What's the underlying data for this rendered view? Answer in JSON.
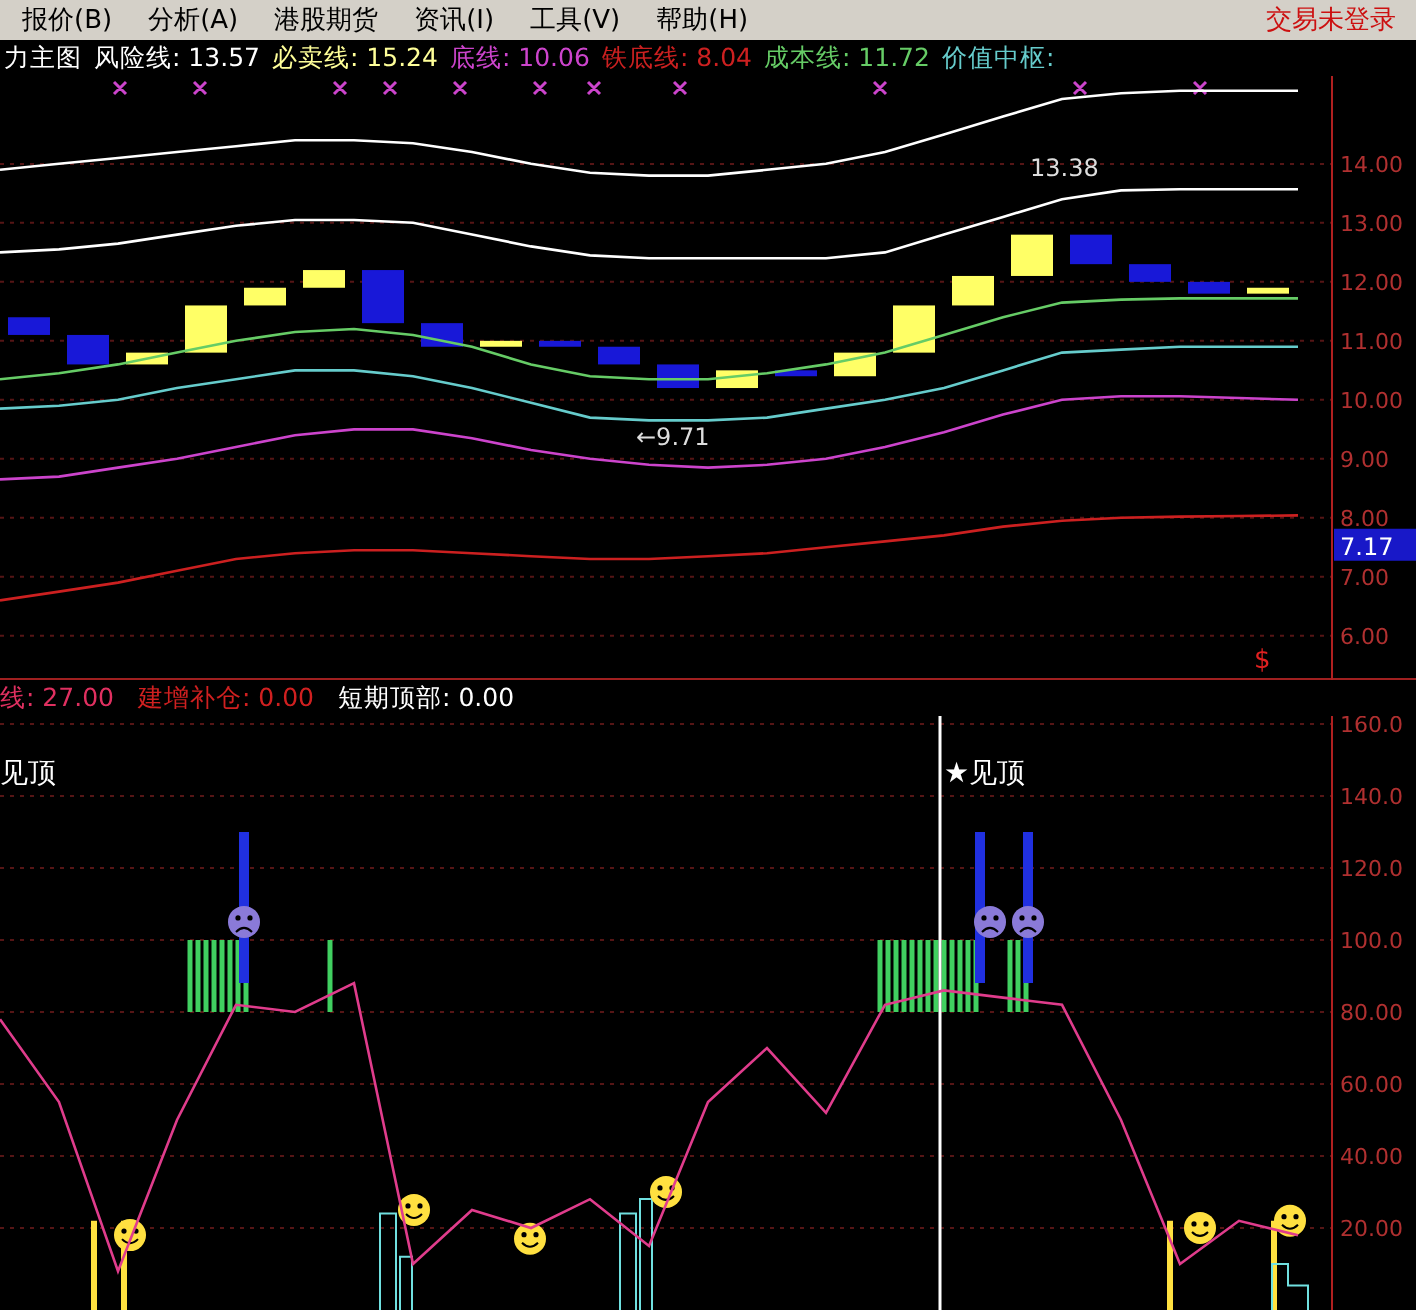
{
  "menu": {
    "items": [
      {
        "label": "报价(B)"
      },
      {
        "label": "分析(A)"
      },
      {
        "label": "港股期货"
      },
      {
        "label": "资讯(I)"
      },
      {
        "label": "工具(V)"
      },
      {
        "label": "帮助(H)"
      }
    ],
    "status": "交易未登录"
  },
  "price_panel": {
    "legend": [
      {
        "kind": "title",
        "label": "力主图",
        "color": "#ffffff"
      },
      {
        "kind": "reading",
        "label": "风险线:",
        "value": "13.57",
        "color": "#ffffff"
      },
      {
        "kind": "reading",
        "label": "必卖线:",
        "value": "15.24",
        "color": "#ffff99"
      },
      {
        "kind": "reading",
        "label": "底线:",
        "value": "10.06",
        "color": "#cc44cc"
      },
      {
        "kind": "reading",
        "label": "铁底线:",
        "value": "8.04",
        "color": "#cc2020"
      },
      {
        "kind": "reading",
        "label": "成本线:",
        "value": "11.72",
        "color": "#66cc66"
      },
      {
        "kind": "title",
        "label": "价值中枢:",
        "color": "#66cccc"
      }
    ],
    "price_tag": "7.17",
    "marker": "$",
    "annotations": [
      {
        "text": "13.38"
      },
      {
        "text": "←9.71"
      }
    ],
    "chart_data": {
      "type": "line",
      "grid": true,
      "ylim": [
        5.25,
        15.49
      ],
      "yticks": [
        {
          "value": 14,
          "label": "14.00"
        },
        {
          "value": 13,
          "label": "13.00"
        },
        {
          "value": 12,
          "label": "12.00"
        },
        {
          "value": 11,
          "label": "11.00"
        },
        {
          "value": 10,
          "label": "10.00"
        },
        {
          "value": 9,
          "label": "9.00"
        },
        {
          "value": 8,
          "label": "8.00"
        },
        {
          "value": 7,
          "label": "7.00"
        },
        {
          "value": 6,
          "label": "6.00"
        }
      ],
      "series": [
        {
          "color": "#ffffff",
          "values": [
            13.9,
            14.0,
            14.1,
            14.2,
            14.3,
            14.4,
            14.4,
            14.35,
            14.2,
            14.0,
            13.85,
            13.8,
            13.8,
            13.9,
            14.0,
            14.2,
            14.5,
            14.8,
            15.1,
            15.2,
            15.24,
            15.24,
            15.24
          ]
        },
        {
          "color": "#ffffff",
          "values": [
            12.5,
            12.55,
            12.65,
            12.8,
            12.95,
            13.05,
            13.05,
            13.0,
            12.8,
            12.6,
            12.45,
            12.4,
            12.4,
            12.4,
            12.4,
            12.5,
            12.8,
            13.1,
            13.4,
            13.55,
            13.57,
            13.57,
            13.57
          ]
        },
        {
          "color": "#66cc66",
          "values": [
            10.35,
            10.45,
            10.6,
            10.8,
            11.0,
            11.15,
            11.2,
            11.1,
            10.9,
            10.6,
            10.4,
            10.35,
            10.35,
            10.45,
            10.6,
            10.8,
            11.1,
            11.4,
            11.65,
            11.7,
            11.72,
            11.72,
            11.72
          ]
        },
        {
          "color": "#66cccc",
          "values": [
            9.85,
            9.9,
            10.0,
            10.2,
            10.35,
            10.5,
            10.5,
            10.4,
            10.2,
            9.95,
            9.7,
            9.65,
            9.65,
            9.7,
            9.85,
            10.0,
            10.2,
            10.5,
            10.8,
            10.85,
            10.9,
            10.9,
            10.9
          ]
        },
        {
          "color": "#cc44cc",
          "values": [
            8.65,
            8.7,
            8.85,
            9.0,
            9.2,
            9.4,
            9.5,
            9.5,
            9.35,
            9.15,
            9.0,
            8.9,
            8.85,
            8.9,
            9.0,
            9.2,
            9.45,
            9.75,
            10.0,
            10.06,
            10.06,
            10.03,
            10.0
          ]
        },
        {
          "color": "#cc2020",
          "values": [
            6.6,
            6.75,
            6.9,
            7.1,
            7.3,
            7.4,
            7.45,
            7.45,
            7.4,
            7.35,
            7.3,
            7.3,
            7.35,
            7.4,
            7.5,
            7.6,
            7.7,
            7.85,
            7.95,
            8.0,
            8.02,
            8.03,
            8.04
          ]
        }
      ]
    }
  },
  "indicator_panel": {
    "legend": [
      {
        "label": "线:",
        "value": "27.00",
        "color": "#e03060"
      },
      {
        "label": "建增补仓:",
        "value": "0.00",
        "color": "#d02020"
      },
      {
        "label": "短期顶部:",
        "value": "0.00",
        "color": "#ffffff"
      }
    ],
    "annotations": [
      {
        "text": "见顶"
      },
      {
        "text": "★见顶"
      }
    ],
    "chart_data": {
      "type": "line",
      "grid": true,
      "ylim": [
        -2.8,
        162.2
      ],
      "yticks": [
        {
          "value": 160,
          "label": "160.0"
        },
        {
          "value": 140,
          "label": "140.0"
        },
        {
          "value": 120,
          "label": "120.0"
        },
        {
          "value": 100,
          "label": "100.0"
        },
        {
          "value": 80,
          "label": "80.00"
        },
        {
          "value": 60,
          "label": "60.00"
        },
        {
          "value": 40,
          "label": "40.00"
        },
        {
          "value": 20,
          "label": "20.00"
        }
      ],
      "series": [
        {
          "color": "#e03c8c",
          "values": [
            78,
            55,
            8,
            50,
            82,
            80,
            88,
            10,
            25,
            20,
            28,
            15,
            55,
            70,
            52,
            82,
            86,
            84,
            82,
            50,
            10,
            22,
            18
          ]
        }
      ]
    }
  }
}
